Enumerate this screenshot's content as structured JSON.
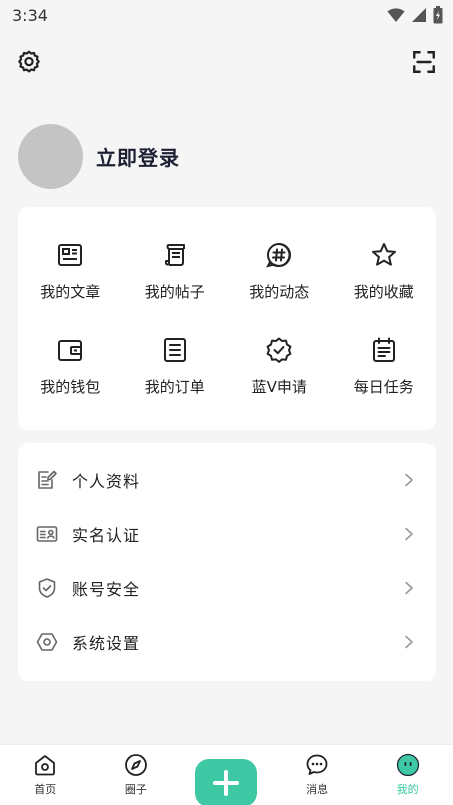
{
  "status_bar": {
    "time": "3:34"
  },
  "profile": {
    "login_label": "立即登录"
  },
  "grid": {
    "items": [
      {
        "label": "我的文章",
        "icon": "article-icon"
      },
      {
        "label": "我的帖子",
        "icon": "post-icon"
      },
      {
        "label": "我的动态",
        "icon": "hashtag-icon"
      },
      {
        "label": "我的收藏",
        "icon": "star-icon"
      },
      {
        "label": "我的钱包",
        "icon": "wallet-icon"
      },
      {
        "label": "我的订单",
        "icon": "order-icon"
      },
      {
        "label": "蓝V申请",
        "icon": "verified-badge-icon"
      },
      {
        "label": "每日任务",
        "icon": "calendar-task-icon"
      }
    ]
  },
  "menu": {
    "items": [
      {
        "label": "个人资料",
        "icon": "edit-profile-icon"
      },
      {
        "label": "实名认证",
        "icon": "id-card-icon"
      },
      {
        "label": "账号安全",
        "icon": "shield-icon"
      },
      {
        "label": "系统设置",
        "icon": "hexagon-settings-icon"
      }
    ]
  },
  "tabbar": {
    "tabs": [
      {
        "label": "首页",
        "icon": "home-icon"
      },
      {
        "label": "圈子",
        "icon": "compass-icon"
      },
      {
        "label": "",
        "icon": "plus-icon"
      },
      {
        "label": "消息",
        "icon": "chat-icon"
      },
      {
        "label": "我的",
        "icon": "mine-face-icon"
      }
    ],
    "active": "我的"
  },
  "colors": {
    "accent": "#3ec8a4",
    "active_tab": "#36c9a3",
    "background": "#f5f5f5"
  }
}
